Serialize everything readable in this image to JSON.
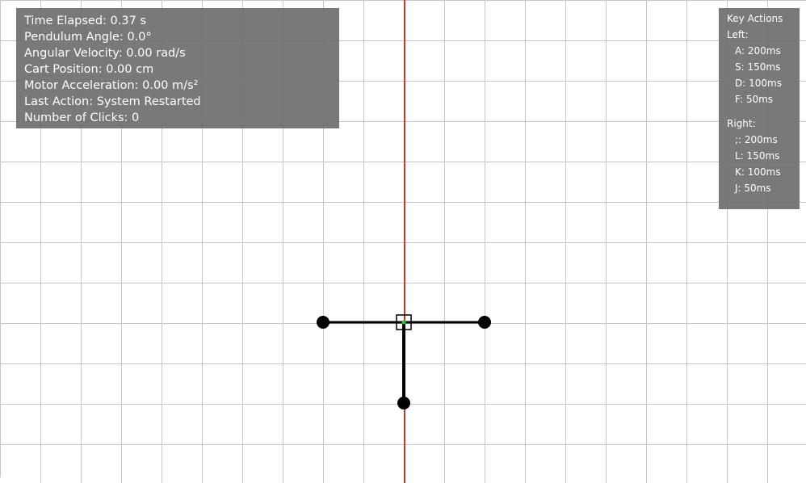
{
  "stats": {
    "time_elapsed": "Time Elapsed: 0.37 s",
    "pendulum_angle": "Pendulum Angle: 0.0°",
    "angular_velocity": "Angular Velocity: 0.00 rad/s",
    "cart_position": "Cart Position: 0.00 cm",
    "motor_acceleration": "Motor Acceleration: 0.00 m/s²",
    "last_action": "Last Action: System Restarted",
    "clicks": "Number of Clicks: 0"
  },
  "key_actions": {
    "title": "Key Actions",
    "left_label": "Left:",
    "left": [
      "A: 200ms",
      "S: 150ms",
      "D: 100ms",
      "F: 50ms"
    ],
    "right_label": "Right:",
    "right": [
      ";: 200ms",
      "L: 150ms",
      "K: 100ms",
      "J: 50ms"
    ]
  },
  "colors": {
    "center_line": "#c8342e",
    "grid": "#c6c6c6",
    "panel_bg": "#6e6e6e",
    "pendulum": "#000000",
    "pivot": "#22c422"
  },
  "icons": {
    "cart": "cart-square-icon",
    "pivot": "pivot-dot-icon",
    "bob": "pendulum-bob-icon"
  }
}
